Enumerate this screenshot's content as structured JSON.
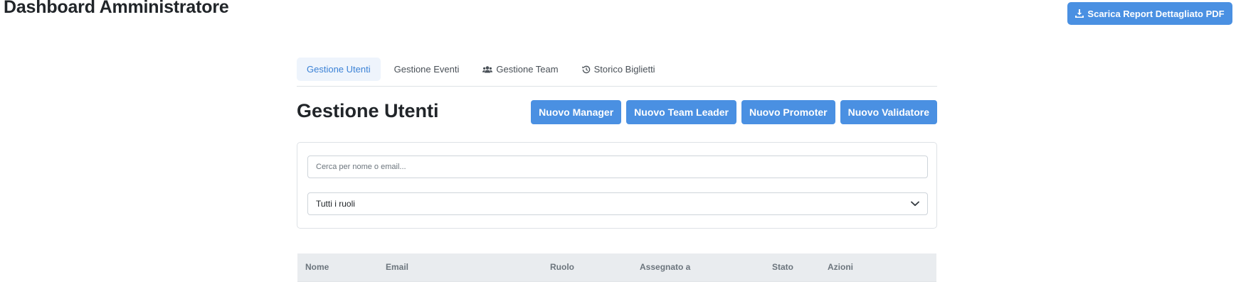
{
  "header": {
    "title": "Dashboard Amministratore",
    "pdf_button_label": "Scarica Report Dettagliato PDF",
    "pdf_button_icon": "download-icon"
  },
  "tabs": [
    {
      "label": "Gestione Utenti",
      "active": true,
      "icon": null
    },
    {
      "label": "Gestione Eventi",
      "active": false,
      "icon": null
    },
    {
      "label": "Gestione Team",
      "active": false,
      "icon": "users-icon"
    },
    {
      "label": "Storico Biglietti",
      "active": false,
      "icon": "history-icon"
    }
  ],
  "section": {
    "title": "Gestione Utenti"
  },
  "actions": {
    "new_manager": "Nuovo Manager",
    "new_team_leader": "Nuovo Team Leader",
    "new_promoter": "Nuovo Promoter",
    "new_validator": "Nuovo Validatore"
  },
  "filters": {
    "search_placeholder": "Cerca per nome o email...",
    "search_value": "",
    "role_selected": "Tutti i ruoli"
  },
  "table": {
    "columns": [
      "Nome",
      "Email",
      "Ruolo",
      "Assegnato a",
      "Stato",
      "Azioni"
    ]
  },
  "colors": {
    "primary": "#4a90e2",
    "active_tab_bg": "#eef4fc",
    "active_tab_text": "#3b82d6",
    "table_header_bg": "#e9ecef"
  }
}
